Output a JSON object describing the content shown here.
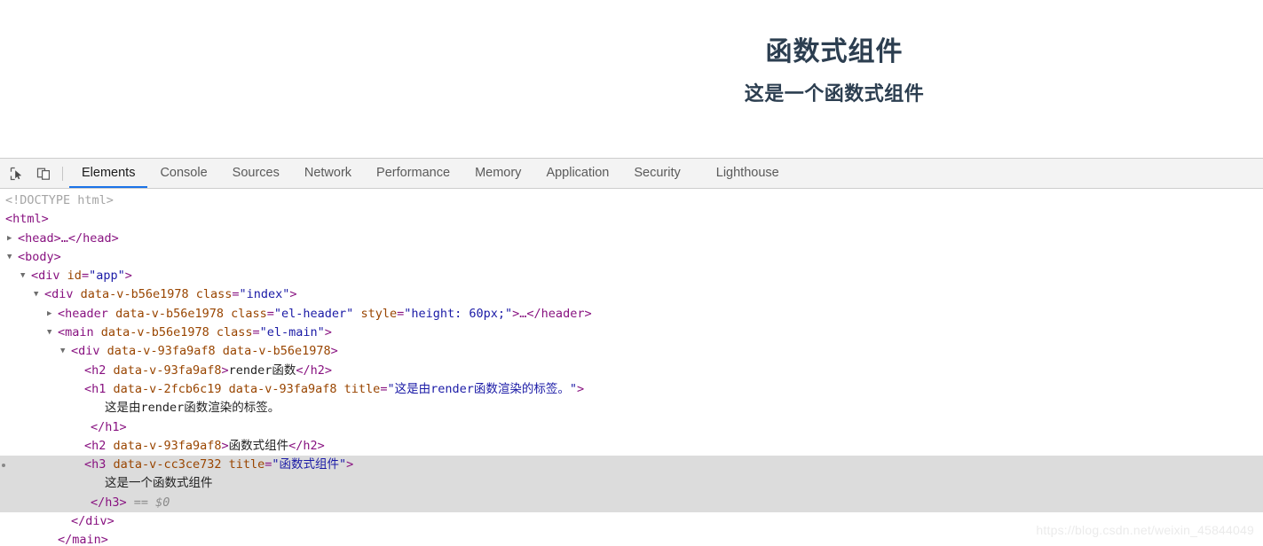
{
  "page": {
    "heading": "函数式组件",
    "subheading": "这是一个函数式组件",
    "heading_color": "#2c3e50"
  },
  "devtools": {
    "accent_color": "#1a73e8",
    "toolbar_bg": "#f3f3f3",
    "selection_bg": "#dcdcdc",
    "buttons": [
      {
        "name": "inspect-element-icon",
        "label": "Inspect element"
      },
      {
        "name": "device-toolbar-icon",
        "label": "Toggle device toolbar"
      }
    ],
    "tabs": [
      {
        "label": "Elements",
        "active": true
      },
      {
        "label": "Console",
        "active": false
      },
      {
        "label": "Sources",
        "active": false
      },
      {
        "label": "Network",
        "active": false
      },
      {
        "label": "Performance",
        "active": false
      },
      {
        "label": "Memory",
        "active": false
      },
      {
        "label": "Application",
        "active": false
      },
      {
        "label": "Security",
        "active": false
      },
      {
        "label": "Lighthouse",
        "active": false
      }
    ],
    "dom_lines": [
      {
        "id": "l0",
        "text": "<!DOCTYPE html>"
      },
      {
        "id": "l1",
        "text": "<html>"
      },
      {
        "id": "l2",
        "text": "<head>…</head>"
      },
      {
        "id": "l3",
        "text": "<body>"
      },
      {
        "id": "l4",
        "text": "<div id=\"app\">"
      },
      {
        "id": "l5",
        "text": "<div data-v-b56e1978 class=\"index\">"
      },
      {
        "id": "l6",
        "text": "<header data-v-b56e1978 class=\"el-header\" style=\"height: 60px;\">…</header>"
      },
      {
        "id": "l7",
        "text": "<main data-v-b56e1978 class=\"el-main\">"
      },
      {
        "id": "l8",
        "text": "<div data-v-93fa9af8 data-v-b56e1978>"
      },
      {
        "id": "l9",
        "text": "<h2 data-v-93fa9af8>render函数</h2>"
      },
      {
        "id": "l10",
        "text": "<h1 data-v-2fcb6c19 data-v-93fa9af8 title=\"这是由render函数渲染的标签。\">"
      },
      {
        "id": "l11",
        "text": "这是由render函数渲染的标签。"
      },
      {
        "id": "l12",
        "text": "</h1>"
      },
      {
        "id": "l13",
        "text": "<h2 data-v-93fa9af8>函数式组件</h2>"
      },
      {
        "id": "l14",
        "text": "<h3 data-v-cc3ce732 title=\"函数式组件\">"
      },
      {
        "id": "l15",
        "text": "这是一个函数式组件"
      },
      {
        "id": "l16",
        "text": "</h3> == $0"
      },
      {
        "id": "l17",
        "text": "</div>"
      },
      {
        "id": "l18",
        "text": "</main>"
      }
    ],
    "dom_tokens": {
      "doctype": "<!DOCTYPE html>",
      "html_open": "<html>",
      "head_collapsed": "<head>…</head>",
      "body_open": "<body>",
      "div_app_tag": "div",
      "div_app_attr": "id",
      "div_app_val": "\"app\"",
      "div_index_tag": "div",
      "div_index_attr1": "data-v-b56e1978",
      "div_index_attr2": "class",
      "div_index_val2": "\"index\"",
      "header_tag": "header",
      "header_attr1": "data-v-b56e1978",
      "header_attr2": "class",
      "header_val2": "\"el-header\"",
      "header_attr3": "style",
      "header_val3": "\"height: 60px;\"",
      "header_close": "…</header>",
      "main_tag": "main",
      "main_attr1": "data-v-b56e1978",
      "main_attr2": "class",
      "main_val2": "\"el-main\"",
      "div_inner_tag": "div",
      "div_inner_attr1": "data-v-93fa9af8",
      "div_inner_attr2": "data-v-b56e1978",
      "h2a_tag": "h2",
      "h2a_attr": "data-v-93fa9af8",
      "h2a_text": "render函数",
      "h1_tag": "h1",
      "h1_attr1": "data-v-2fcb6c19",
      "h1_attr2": "data-v-93fa9af8",
      "h1_attr3": "title",
      "h1_val3": "\"这是由render函数渲染的标签。\"",
      "h1_text": "这是由render函数渲染的标签。",
      "h2b_tag": "h2",
      "h2b_attr": "data-v-93fa9af8",
      "h2b_text": "函数式组件",
      "h3_tag": "h3",
      "h3_attr1": "data-v-cc3ce732",
      "h3_attr2": "title",
      "h3_val2": "\"函数式组件\"",
      "h3_text": "这是一个函数式组件",
      "selected_marker": "== $0",
      "div_close": "</div>",
      "main_close": "</main>",
      "h1_close": "</h1>",
      "h2_close": "</h2>",
      "h3_close": "</h3>"
    }
  },
  "watermark": "https://blog.csdn.net/weixin_45844049"
}
